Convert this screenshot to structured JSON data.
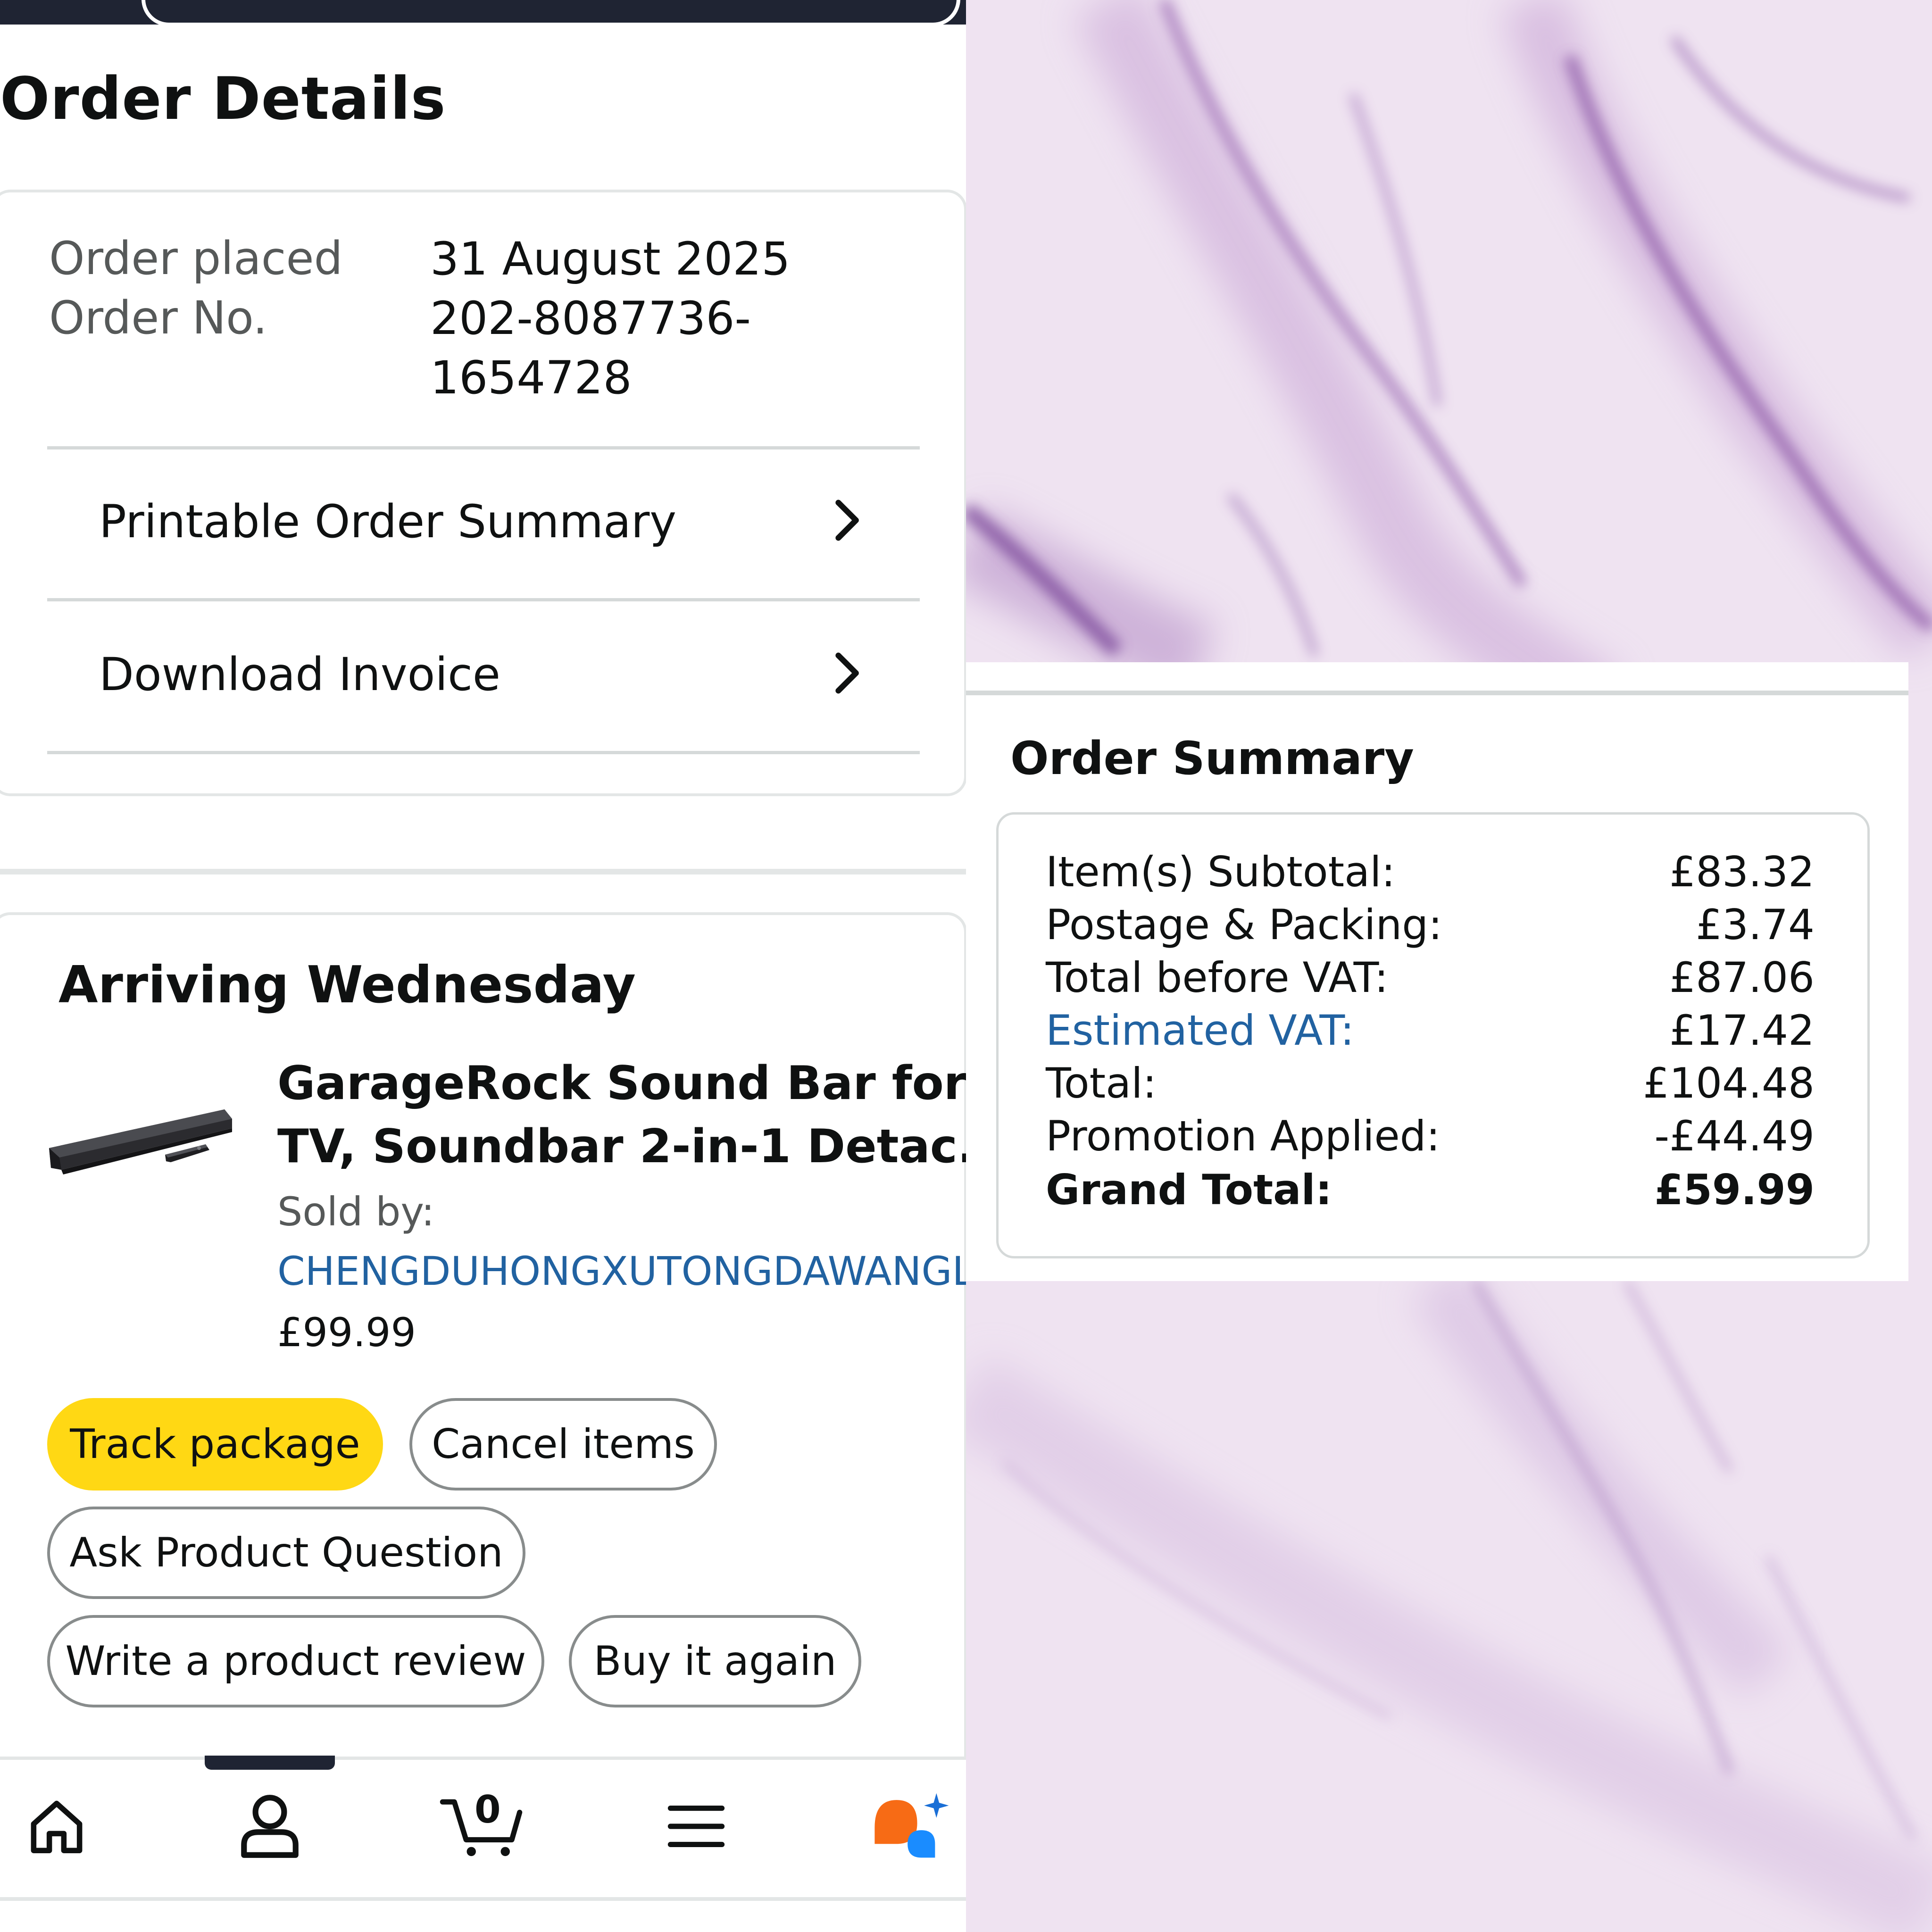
{
  "page": {
    "title": "Order Details"
  },
  "order": {
    "placed_label": "Order placed",
    "placed_value": "31 August 2025",
    "number_label": "Order No.",
    "number_line1": "202-8087736-",
    "number_line2": "1654728"
  },
  "links": {
    "printable_summary": "Printable Order Summary",
    "download_invoice": "Download Invoice"
  },
  "shipment": {
    "title": "Arriving Wednesday",
    "product_title_line1": "GarageRock Sound Bar for",
    "product_title_line2": "TV, Soundbar 2-in-1 Detac...",
    "sold_by_label": "Sold by:",
    "seller": "CHENGDUHONGXUTONGDAWANGLUOKEJIYOUXIANGONGSI",
    "price": "£99.99"
  },
  "actions": {
    "track": "Track package",
    "cancel": "Cancel items",
    "ask": "Ask Product Question",
    "review": "Write a product review",
    "buy_again": "Buy it again"
  },
  "bottom_nav": {
    "items": [
      "home-icon",
      "account-icon",
      "cart-icon",
      "menu-icon",
      "rufus-ai-icon"
    ],
    "cart_count": "0"
  },
  "summary": {
    "title": "Order Summary",
    "rows": [
      {
        "label": "Item(s) Subtotal:",
        "value": "£83.32"
      },
      {
        "label": "Postage & Packing:",
        "value": "£3.74"
      },
      {
        "label": "Total before VAT:",
        "value": "£87.06"
      },
      {
        "label": "Estimated VAT:",
        "value": "£17.42"
      },
      {
        "label": "Total:",
        "value": "£104.48"
      },
      {
        "label": "Promotion Applied:",
        "value": "-£44.49"
      },
      {
        "label": "Grand Total:",
        "value": "£59.99"
      }
    ]
  },
  "colors": {
    "primary_button": "#ffd814",
    "link": "#2162a1",
    "marble_base": "#efe3f1",
    "marble_vein": "#8e5aa8",
    "rufus_orange": "#f76b15",
    "rufus_blue": "#1a8cff"
  }
}
